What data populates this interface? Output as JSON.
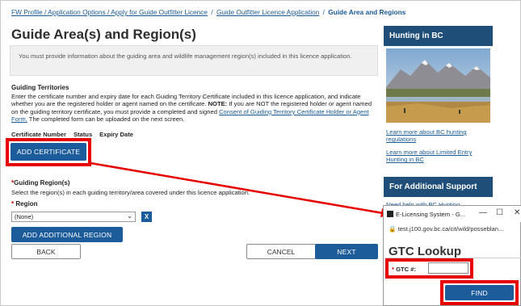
{
  "breadcrumb": {
    "items": [
      "FW Profile / Application Options / Apply for Guide Outfitter Licence",
      "Guide Outfitter Licence Application"
    ],
    "separator": "/",
    "current": "Guide Area and Regions"
  },
  "page_title": "Guide Area(s) and Region(s)",
  "info_text": "You must provide information about the guiding area and wildlife management region(s) included in this licence application.",
  "guiding_territories": {
    "heading": "Guiding Territories",
    "para_1": "Enter the certificate number and expiry date for each Guiding Territory Certificate included in this licence application, and indicate whether you are the registered holder or agent named on the certificate. ",
    "note_label": "NOTE:",
    "para_2": " If you are NOT the registered holder or agent named on the guiding territory certificate, you must provide a completed and signed ",
    "consent_link": "Consent of Guiding Territory Certificate Holder or Agent Form.",
    "para_3": " The completed form can be uploaded on the next screen.",
    "columns": [
      "Certificate Number",
      "Status",
      "Expiry Date"
    ],
    "add_certificate_label": "ADD CERTIFICATE"
  },
  "guiding_regions": {
    "required_mark": "*",
    "heading": "Guiding Region(s)",
    "description": "Select the region(s) in each guiding territory/area covered under this licence application.",
    "region_label": "Region",
    "region_value": "(None)",
    "remove_label": "X",
    "add_region_label": "ADD ADDITIONAL REGION"
  },
  "nav": {
    "back_label": "BACK",
    "cancel_label": "CANCEL",
    "next_label": "NEXT"
  },
  "sidebar": {
    "hunting_heading": "Hunting in BC",
    "link_1": "Learn more about BC hunting regulations",
    "link_2": "Learn more about Limited Entry Hunting in BC",
    "support_heading": "For Additional Support",
    "support_link": "Need help with BC Hunting"
  },
  "popup": {
    "window_title": "E-Licensing System - G...",
    "minimize": "—",
    "maximize": "☐",
    "close": "✕",
    "url": "test.j100.gov.bc.ca/cit/wild/posseblan...",
    "title": "GTC Lookup",
    "gtc_label": "GTC #:",
    "required_mark": "*",
    "find_label": "FIND"
  },
  "colors": {
    "primary_button": "#1c5c9b",
    "sidebar_header": "#1f4e79",
    "highlight_red": "#e60000",
    "link": "#1a5a96"
  }
}
